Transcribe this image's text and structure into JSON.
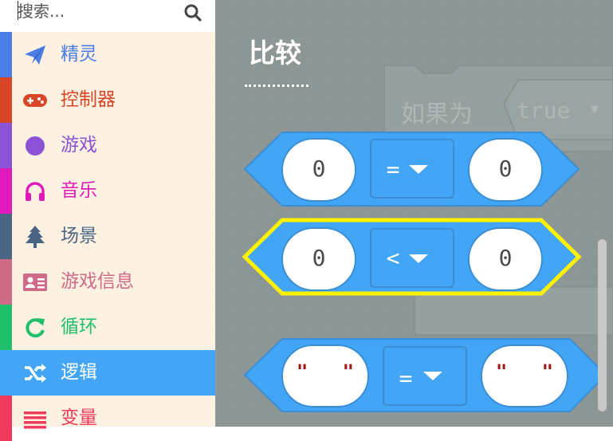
{
  "search": {
    "placeholder": "搜索..."
  },
  "sidebar": {
    "items": [
      {
        "label": "精灵",
        "icon": "paper-plane-icon",
        "color": "#4c7ce6"
      },
      {
        "label": "控制器",
        "icon": "gamepad-icon",
        "color": "#d84527"
      },
      {
        "label": "游戏",
        "icon": "circle-icon",
        "color": "#8c52d6"
      },
      {
        "label": "音乐",
        "icon": "headphones-icon",
        "color": "#e01aba"
      },
      {
        "label": "场景",
        "icon": "tree-icon",
        "color": "#4b6584"
      },
      {
        "label": "游戏信息",
        "icon": "id-card-icon",
        "color": "#cf6a87"
      },
      {
        "label": "循环",
        "icon": "refresh-icon",
        "color": "#20bf6b"
      },
      {
        "label": "逻辑",
        "icon": "shuffle-icon",
        "color": "#42a5f5",
        "active": true
      },
      {
        "label": "变量",
        "icon": "list-icon",
        "color": "#ef3a5d"
      }
    ]
  },
  "workspace": {
    "flyout_title": "比较",
    "bg_block": {
      "label": "如果为",
      "value": "true"
    },
    "blocks": [
      {
        "left": "0",
        "op": "=",
        "right": "0",
        "kind": "number"
      },
      {
        "left": "0",
        "op": "<",
        "right": "0",
        "kind": "number",
        "highlighted": true
      },
      {
        "left": "\"   \"",
        "op": "=",
        "right": "\"   \"",
        "kind": "string"
      }
    ]
  },
  "colors": {
    "logic_block": "#42a5f5",
    "logic_block_border": "#3b8ed3",
    "highlight": "#fff200",
    "workspace_bg": "#8c9795",
    "sidebar_bg": "#fdf1e1",
    "string_quote": "#a31515"
  }
}
